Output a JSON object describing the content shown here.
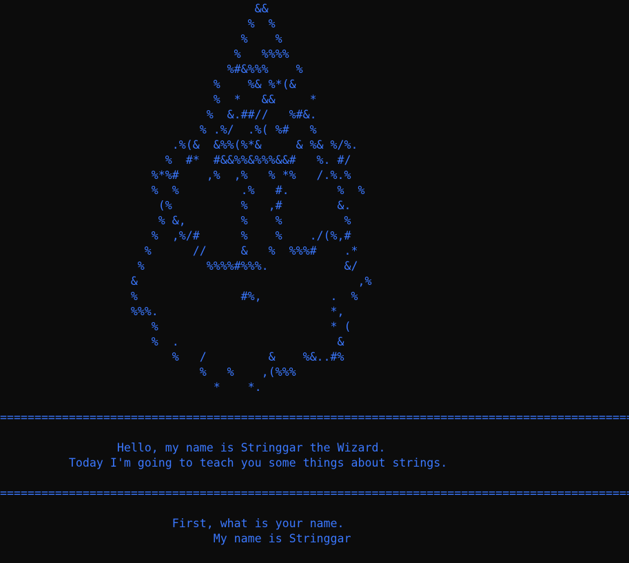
{
  "terminal": {
    "colors": {
      "background": "#0c0c0c",
      "foreground": "#3b78ff"
    },
    "ascii_art": "                                     &&\n                                    %  %\n                                   %    %\n                                  %   %%%%\n                                 %#&%%%    %\n                               %    %& %*(&\n                               %  *   &&     *\n                              %  &.##//   %#&.\n                             % .%/  .%( %#   %\n                         .%(&  &%%(%*&     & %& %/%.\n                        %  #*  #&&%%&%%%&&#   %. #/\n                      %*%#    ,%  ,%   % *%   /.%.%\n                      %  %         .%   #.       %  %\n                       (%          %   ,#        &.\n                       % &,        %    %         %\n                      %  ,%/#      %    %    ./(%,#\n                     %      //     &   %  %%%#    .*\n                    %         %%%%#%%%.           &/\n                   &                                ,%\n                   %               #%,          .  %\n                   %%%.                         *,\n                      %                         * (\n                      %  .                       &\n                         %   /         &    %&..#%\n                             %   %    ,(%%%\n                               *    *.",
    "divider": "=============================================================================================",
    "greeting_line_1": "                 Hello, my name is Stringgar the Wizard.",
    "greeting_line_2": "          Today I'm going to teach you some things about strings.",
    "question_line": "                         First, what is your name.",
    "answer_line": "                               My name is Stringgar"
  }
}
